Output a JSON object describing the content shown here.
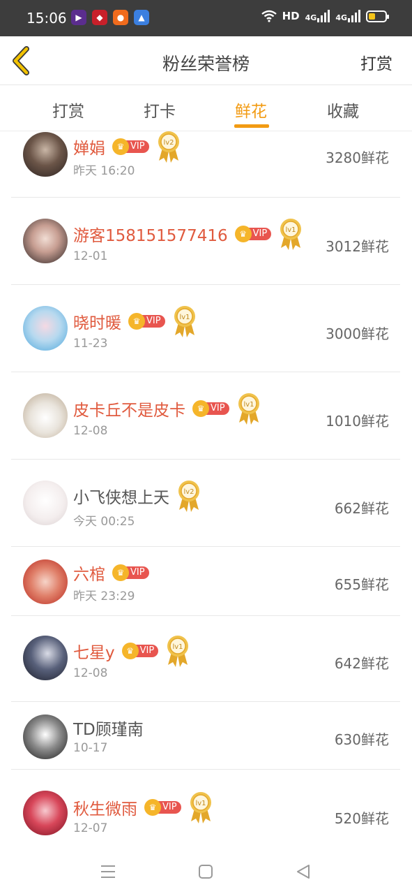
{
  "status": {
    "time": "15:06",
    "hd": "HD",
    "net1": "4G",
    "net2": "4G"
  },
  "header": {
    "title": "粉丝荣誉榜",
    "right_action": "打赏"
  },
  "tabs": [
    {
      "label": "打赏",
      "active": false
    },
    {
      "label": "打卡",
      "active": false
    },
    {
      "label": "鲜花",
      "active": true
    },
    {
      "label": "收藏",
      "active": false
    }
  ],
  "colors": {
    "accent": "#f29b13",
    "vip_name": "#e05a3e",
    "vip_tag": "#e8554f"
  },
  "vip_label": "VIP",
  "rows": [
    {
      "name": "婵娟",
      "vip": true,
      "medal": "lv2",
      "time": "昨天 16:20",
      "amount": "3280鲜花"
    },
    {
      "name": "游客158151577416",
      "vip": true,
      "medal": "lv1",
      "time": "12-01",
      "amount": "3012鲜花"
    },
    {
      "name": "晓时暖",
      "vip": true,
      "medal": "lv1",
      "time": "11-23",
      "amount": "3000鲜花"
    },
    {
      "name": "皮卡丘不是皮卡",
      "vip": true,
      "medal": "lv1",
      "time": "12-08",
      "amount": "1010鲜花"
    },
    {
      "name": "小飞侠想上天",
      "vip": false,
      "medal": "lv2",
      "time": "今天 00:25",
      "amount": "662鲜花"
    },
    {
      "name": "六棺",
      "vip": true,
      "medal": "",
      "time": "昨天 23:29",
      "amount": "655鲜花"
    },
    {
      "name": "七星y",
      "vip": true,
      "medal": "lv1",
      "time": "12-08",
      "amount": "642鲜花"
    },
    {
      "name": "TD顾瑾南",
      "vip": false,
      "medal": "",
      "time": "10-17",
      "amount": "630鲜花"
    },
    {
      "name": "秋生微雨",
      "vip": true,
      "medal": "lv1",
      "time": "12-07",
      "amount": "520鲜花"
    }
  ]
}
